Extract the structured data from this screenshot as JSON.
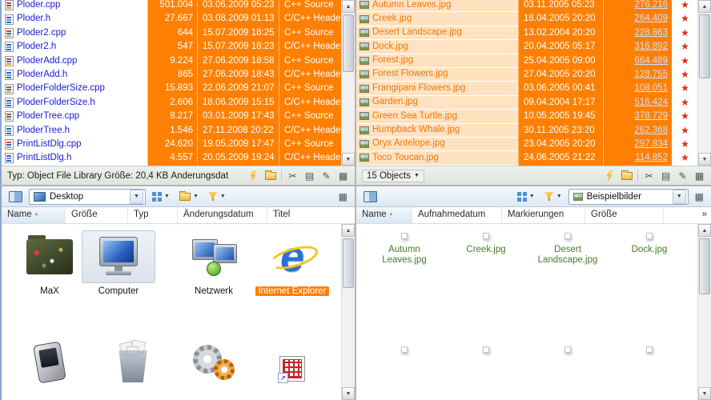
{
  "left_list": {
    "rows": [
      {
        "name": "Ploder.cpp",
        "size": "501.004",
        "date": "03.06.2009 05:23",
        "type": "C++ Source"
      },
      {
        "name": "Ploder.h",
        "size": "27.667",
        "date": "03.08.2009 01:13",
        "type": "C/C++ Header"
      },
      {
        "name": "Ploder2.cpp",
        "size": "644",
        "date": "15.07.2009 18:25",
        "type": "C++ Source"
      },
      {
        "name": "Ploder2.h",
        "size": "547",
        "date": "15.07.2009 18:23",
        "type": "C/C++ Header"
      },
      {
        "name": "PloderAdd.cpp",
        "size": "9.224",
        "date": "27.06.2009 18:58",
        "type": "C++ Source"
      },
      {
        "name": "PloderAdd.h",
        "size": "865",
        "date": "27.06.2009 18:43",
        "type": "C/C++ Header"
      },
      {
        "name": "PloderFolderSize.cpp",
        "size": "15.893",
        "date": "22.06.2009 21:07",
        "type": "C++ Source"
      },
      {
        "name": "PloderFolderSize.h",
        "size": "2.606",
        "date": "18.06.2009 15:15",
        "type": "C/C++ Header"
      },
      {
        "name": "PloderTree.cpp",
        "size": "8.217",
        "date": "03.01.2009 17:43",
        "type": "C++ Source"
      },
      {
        "name": "PloderTree.h",
        "size": "1.546",
        "date": "27.11.2008 20:22",
        "type": "C/C++ Header"
      },
      {
        "name": "PrintListDlg.cpp",
        "size": "24.620",
        "date": "19.05.2009 17:47",
        "type": "C++ Source"
      },
      {
        "name": "PrintListDlg.h",
        "size": "4.557",
        "date": "20.05.2009 19:24",
        "type": "C/C++ Header"
      }
    ]
  },
  "left_status": {
    "text": "Typ: Object File Library Größe: 20,4 KB Änderungsdat"
  },
  "right_list": {
    "rows": [
      {
        "name": "Autumn Leaves.jpg",
        "date": "03.11.2005 05:23",
        "size": "276.216"
      },
      {
        "name": "Creek.jpg",
        "date": "18.04.2005 20:20",
        "size": "264.409"
      },
      {
        "name": "Desert Landscape.jpg",
        "date": "13.02.2004 20:20",
        "size": "228.863"
      },
      {
        "name": "Dock.jpg",
        "date": "20.04.2005 05:17",
        "size": "316.892"
      },
      {
        "name": "Forest.jpg",
        "date": "25.04.2005 09:00",
        "size": "664.489"
      },
      {
        "name": "Forest Flowers.jpg",
        "date": "27.04.2005 20:20",
        "size": "128.755"
      },
      {
        "name": "Frangipani Flowers.jpg",
        "date": "03.06.2005 00:41",
        "size": "108.051"
      },
      {
        "name": "Garden.jpg",
        "date": "09.04.2004 17:17",
        "size": "516.424"
      },
      {
        "name": "Green Sea Turtle.jpg",
        "date": "10.05.2005 19:45",
        "size": "378.729"
      },
      {
        "name": "Humpback Whale.jpg",
        "date": "30.11.2005 23:20",
        "size": "262.368"
      },
      {
        "name": "Oryx Antelope.jpg",
        "date": "23.04.2005 20:20",
        "size": "297.834"
      },
      {
        "name": "Toco Toucan.jpg",
        "date": "24.06.2005 21:22",
        "size": "114.852"
      }
    ]
  },
  "right_status": {
    "count_label": "15 Objects"
  },
  "bottom_left": {
    "combo_value": "Desktop",
    "headers": [
      "Name",
      "Größe",
      "Typ",
      "Änderungsdatum",
      "Titel"
    ],
    "items": [
      {
        "label": "MaX"
      },
      {
        "label": "Computer"
      },
      {
        "label": "Netzwerk"
      },
      {
        "label": "Internet Explorer"
      },
      {
        "label": ""
      },
      {
        "label": ""
      },
      {
        "label": ""
      },
      {
        "label": ""
      }
    ]
  },
  "bottom_right": {
    "combo_value": "Beispielbilder",
    "headers": [
      "Name",
      "Aufnahmedatum",
      "Markierungen",
      "Größe"
    ],
    "header_overflow": "»",
    "thumbs": [
      {
        "label": "Autumn Leaves.jpg"
      },
      {
        "label": "Creek.jpg"
      },
      {
        "label": "Desert Landscape.jpg"
      },
      {
        "label": "Dock.jpg"
      },
      {
        "label": ""
      },
      {
        "label": ""
      },
      {
        "label": ""
      },
      {
        "label": ""
      }
    ]
  },
  "icons": {
    "caret_down": "▼",
    "caret_up": "▲",
    "chevrons": "»",
    "star": "★",
    "scissors": "✂",
    "pencil": "✎",
    "copy_sheet": "▤",
    "grid": "▦",
    "arrow_ne": "↗",
    "sort_asc": "▴",
    "ie_letter": "e"
  },
  "colors": {
    "selection": "#FF8000",
    "peach": "#FFE2C2",
    "name-blue": "#1A1AD0",
    "image-orange": "#F07800",
    "size-link": "#CFE0FF",
    "label-green": "#467A28",
    "star-red": "#E03010"
  }
}
